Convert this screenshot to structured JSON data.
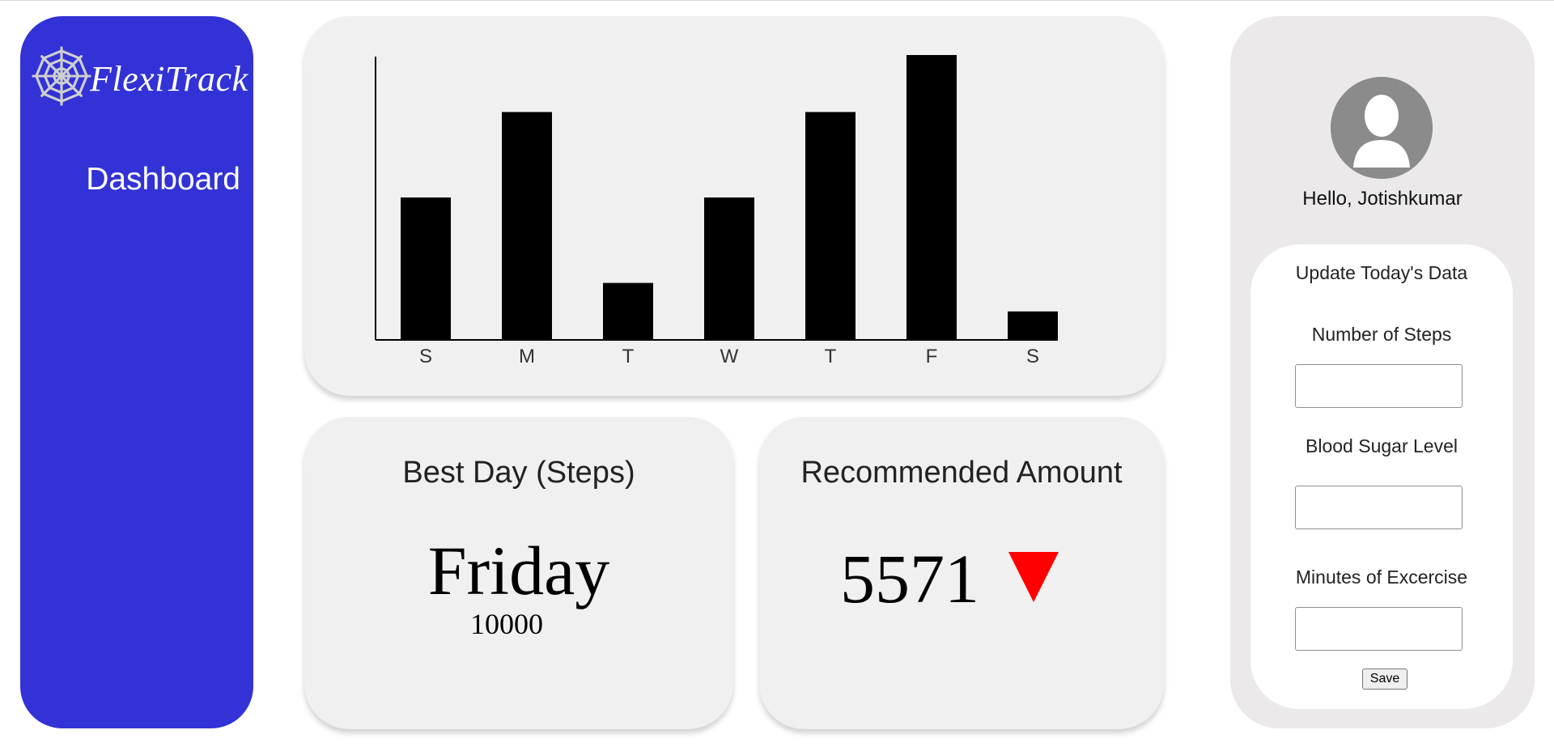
{
  "sidebar": {
    "logo_text": "FlexiTrack",
    "logo_icon": "spiderweb-icon",
    "nav_items": [
      {
        "label": "Dashboard"
      }
    ]
  },
  "chart_data": {
    "type": "bar",
    "categories": [
      "S",
      "M",
      "T",
      "W",
      "T",
      "F",
      "S"
    ],
    "values": [
      5000,
      8000,
      2000,
      5000,
      8000,
      10000,
      1000
    ],
    "ylim": [
      0,
      10000
    ],
    "title": "",
    "xlabel": "",
    "ylabel": "",
    "bar_color": "#000000"
  },
  "best_day": {
    "title": "Best Day (Steps)",
    "day": "Friday",
    "steps": "10000"
  },
  "recommended": {
    "title": "Recommended Amount",
    "value": "5571",
    "trend_icon": "down-triangle-icon",
    "trend_color": "#ff0000"
  },
  "profile": {
    "greeting": "Hello, Jotishkumar",
    "avatar_icon": "user-avatar-icon"
  },
  "form": {
    "heading": "Update Today's Data",
    "fields": [
      {
        "label": "Number of Steps",
        "value": ""
      },
      {
        "label": "Blood Sugar Level",
        "value": ""
      },
      {
        "label": "Minutes of Excercise",
        "value": ""
      }
    ],
    "save_label": "Save"
  },
  "colors": {
    "sidebar": "#3232d6",
    "card": "#f0f0f0",
    "panel": "#ebe9e9"
  }
}
